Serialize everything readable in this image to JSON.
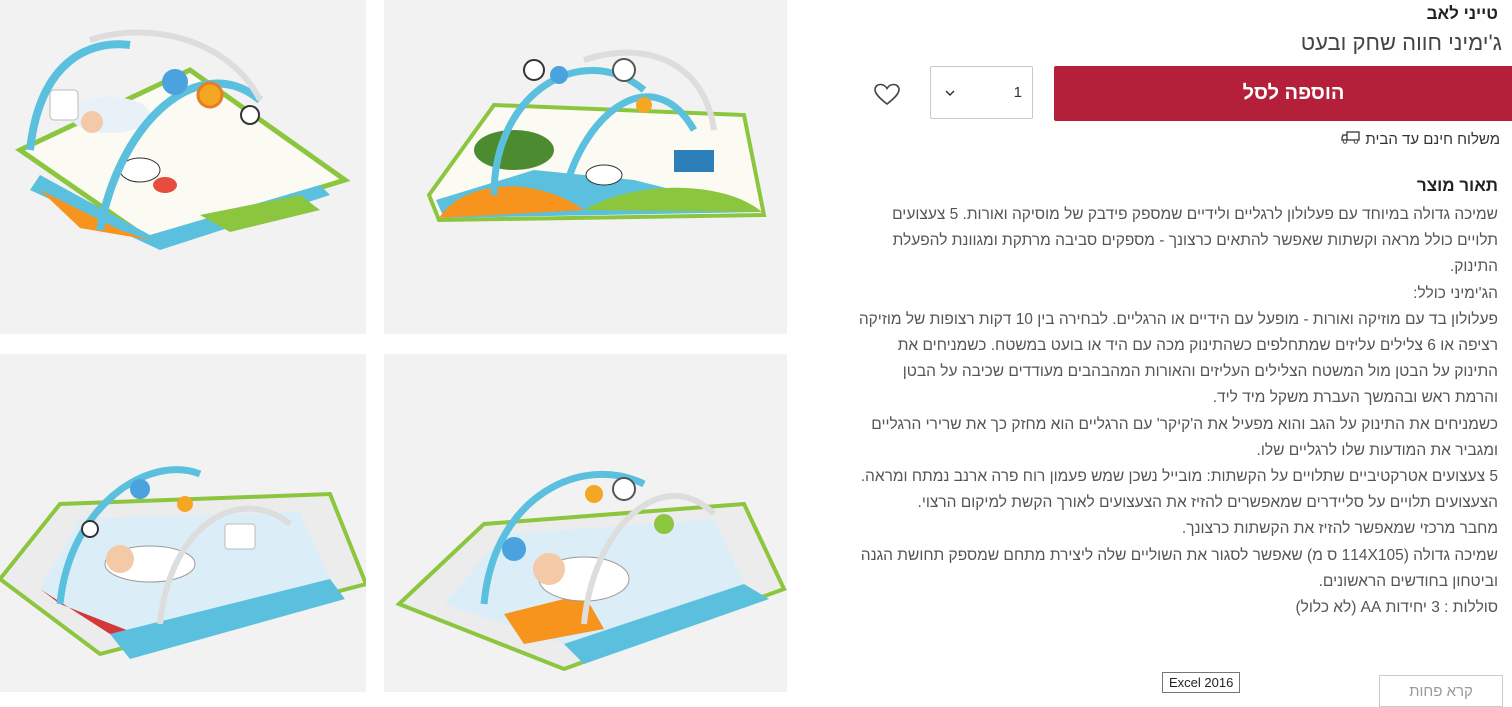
{
  "product": {
    "brand": "טייני לאב",
    "title": "ג'ימיני חווה שחק ובעט"
  },
  "purchase": {
    "add_to_cart_label": "הוספה לסל",
    "quantity_value": "1",
    "shipping_text": "משלוח חינם עד הבית"
  },
  "description": {
    "heading": "תאור מוצר",
    "paragraphs": [
      "שמיכה גדולה במיוחד עם פעלולון לרגליים ולידיים שמספק פידבק של מוסיקה ואורות. 5 צעצועים תלויים כולל מראה וקשתות שאפשר להתאים כרצונך - מספקים סביבה מרתקת ומגוונת להפעלת התינוק.",
      "הג'ימיני כולל:",
      "פעלולון בד עם מוזיקה ואורות - מופעל עם הידיים או הרגליים. לבחירה בין 10 דקות רצופות של מוזיקה רציפה או 6 צלילים עליזים שמתחלפים כשהתינוק מכה עם היד או בועט במשטח. כשמניחים את התינוק על הבטן מול המשטח הצלילים העליזים והאורות המהבהבים מעודדים שכיבה על הבטן והרמת ראש ובהמשך העברת משקל מיד ליד.",
      "כשמניחים את התינוק על הגב והוא מפעיל את ה'קיקר' עם הרגליים הוא מחזק כך את שרירי הרגליים ומגביר את המודעות שלו לרגליים שלו.",
      "5 צעצועים אטרקטיביים שתלויים על הקשתות: מובייל נשכן שמש פעמון רוח פרה ארנב נמתח ומראה. הצעצועים תלויים על סליידרים שמאפשרים להזיז את הצעצועים לאורך הקשת למיקום הרצוי.",
      "מחבר מרכזי שמאפשר להזיז את הקשתות כרצונך.",
      "שמיכה גדולה (114X105 ס מ) שאפשר לסגור את השוליים שלה ליצירת מתחם שמספק תחושת הגנה וביטחון בחודשים הראשונים.",
      "סוללות : 3 יחידות AA (לא כלול)"
    ],
    "read_less_label": "קרא פחות"
  },
  "tooltip": {
    "text": "Excel 2016"
  },
  "colors": {
    "accent": "#b4203a",
    "tile_background": "#f2f2f2"
  }
}
